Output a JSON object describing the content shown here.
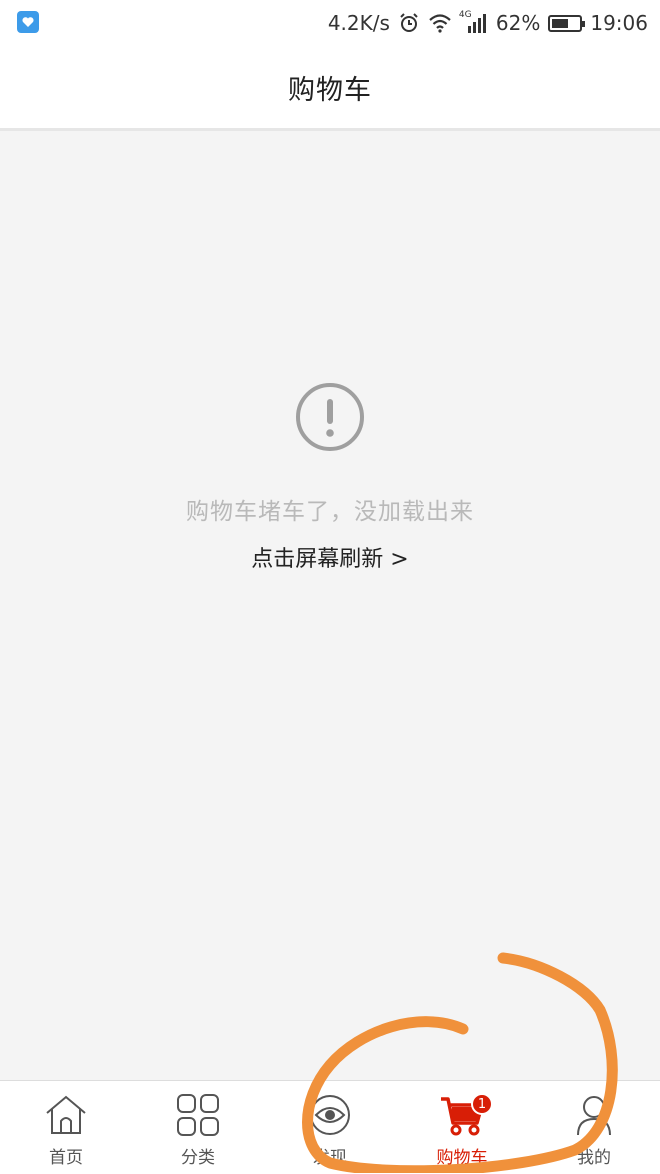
{
  "status_bar": {
    "speed": "4.2K/s",
    "network_type": "4G",
    "battery_percent": "62%",
    "battery_level": 0.62,
    "time": "19:06",
    "icons": [
      "app-notification-icon",
      "alarm-icon",
      "wifi-icon",
      "signal-icon",
      "battery-icon"
    ]
  },
  "header": {
    "title": "购物车"
  },
  "error": {
    "icon": "exclamation-circle-icon",
    "message": "购物车堵车了，没加载出来",
    "refresh_label": "点击屏幕刷新 >"
  },
  "tab_bar": {
    "active": "cart",
    "tabs": [
      {
        "id": "home",
        "label": "首页",
        "icon": "home-icon"
      },
      {
        "id": "category",
        "label": "分类",
        "icon": "grid-icon"
      },
      {
        "id": "discover",
        "label": "发现",
        "icon": "eye-icon"
      },
      {
        "id": "cart",
        "label": "购物车",
        "icon": "cart-icon",
        "badge": "1"
      },
      {
        "id": "me",
        "label": "我的",
        "icon": "user-icon"
      }
    ]
  },
  "colors": {
    "accent": "#d81e06",
    "background": "#f4f4f4",
    "annotation": "#f0913b"
  }
}
